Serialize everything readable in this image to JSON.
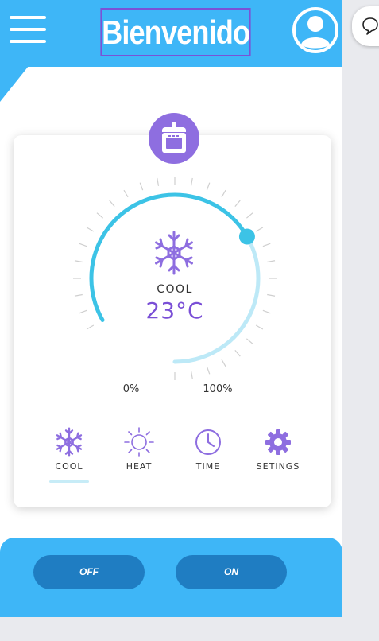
{
  "header": {
    "title": "Bienvenido",
    "menu_icon": "hamburger-menu-icon",
    "avatar_icon": "user-avatar-icon",
    "chat_icon": "speech-bubble-icon"
  },
  "device": {
    "icon": "oven-icon"
  },
  "thermostat": {
    "mode": "COOL",
    "temperature": "23°C",
    "min_label": "0%",
    "max_label": "100%",
    "level": 0.6
  },
  "modes": [
    {
      "label": "COOL",
      "icon": "snowflake-icon",
      "active": true
    },
    {
      "label": "HEAT",
      "icon": "sun-icon",
      "active": false
    },
    {
      "label": "TIME",
      "icon": "clock-icon",
      "active": false
    },
    {
      "label": "SETINGS",
      "icon": "gear-icon",
      "active": false
    }
  ],
  "controls": {
    "off_label": "OFF",
    "on_label": "ON"
  },
  "colors": {
    "primary": "#3eb6f7",
    "accent": "#8e6ee0",
    "button": "#1f7dc2",
    "dial_active": "#3cc3e6",
    "dial_inactive": "#bde9f7"
  }
}
